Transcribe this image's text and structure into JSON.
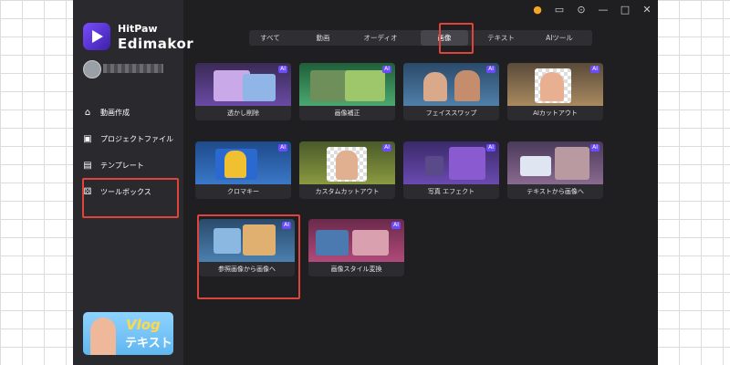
{
  "app": {
    "brand_small": "HitPaw",
    "brand_big": "Edimakor",
    "sidebar": {
      "items": [
        {
          "label": "動画作成",
          "icon": "home-icon"
        },
        {
          "label": "プロジェクトファイル",
          "icon": "folder-icon"
        },
        {
          "label": "テンプレート",
          "icon": "template-icon"
        },
        {
          "label": "ツールボックス",
          "icon": "toolbox-icon"
        }
      ],
      "promo": {
        "title": "Vlog",
        "subtitle": "テキスト"
      }
    },
    "tabs": [
      {
        "label": "すべて"
      },
      {
        "label": "動画"
      },
      {
        "label": "オーディオ"
      },
      {
        "label": "画像",
        "active": true
      },
      {
        "label": "テキスト"
      },
      {
        "label": "AIツール"
      }
    ],
    "ai_badge": "AI",
    "tools": [
      {
        "label": "透かし削除"
      },
      {
        "label": "画像補正"
      },
      {
        "label": "フェイススワップ"
      },
      {
        "label": "AIカットアウト"
      },
      {
        "label": "クロマキー"
      },
      {
        "label": "カスタムカットアウト"
      },
      {
        "label": "写真 エフェクト"
      },
      {
        "label": "テキストから画像へ"
      },
      {
        "label": "参照画像から画像へ"
      },
      {
        "label": "画像スタイル変換"
      }
    ]
  },
  "colors": {
    "app_bg": "#1f1f22",
    "sidebar_bg": "#2a2a2e",
    "accent": "#6b4bff",
    "highlight": "#e0433b"
  }
}
